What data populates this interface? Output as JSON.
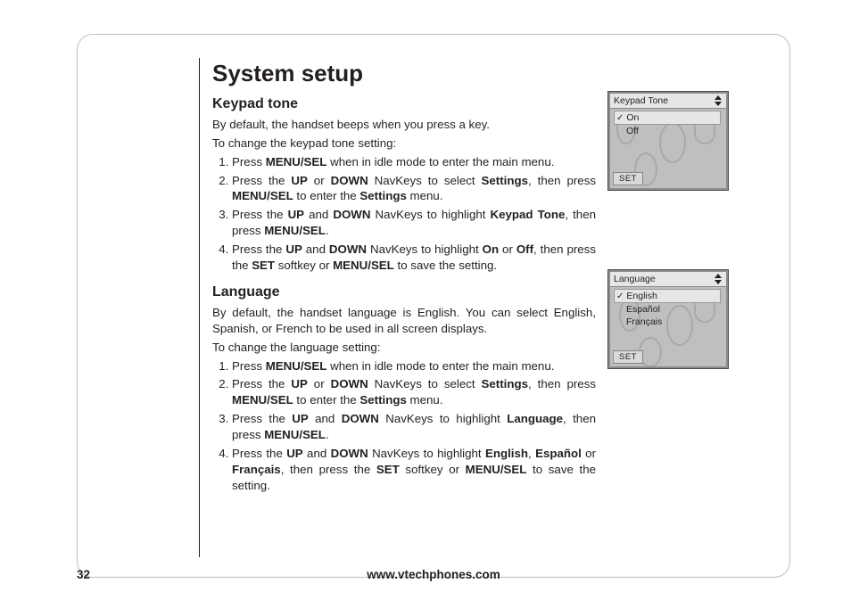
{
  "page": {
    "title": "System setup",
    "number": "32",
    "footer_url": "www.vtechphones.com"
  },
  "section1": {
    "heading": "Keypad tone",
    "intro1": "By default, the handset beeps when you press a key.",
    "intro2": "To change the keypad tone setting:",
    "steps": {
      "s1a": "Press ",
      "s1b": "MENU/SEL",
      "s1c": " when in idle mode to enter the main menu.",
      "s2a": "Press the ",
      "s2b": "UP",
      "s2c": " or ",
      "s2d": "DOWN",
      "s2e": " NavKeys to select ",
      "s2f": "Settings",
      "s2g": ", then press ",
      "s2h": "MENU/SEL",
      "s2i": " to enter the ",
      "s2j": "Settings",
      "s2k": " menu.",
      "s3a": "Press the ",
      "s3b": "UP",
      "s3c": " and ",
      "s3d": "DOWN",
      "s3e": " NavKeys to highlight ",
      "s3f": "Keypad Tone",
      "s3g": ", then press ",
      "s3h": "MENU/SEL",
      "s3i": ".",
      "s4a": "Press the ",
      "s4b": "UP",
      "s4c": " and ",
      "s4d": "DOWN",
      "s4e": " NavKeys to highlight ",
      "s4f": "On",
      "s4g": " or ",
      "s4h": "Off",
      "s4i": ", then press the ",
      "s4j": "SET",
      "s4k": " softkey or ",
      "s4l": "MENU/SEL",
      "s4m": " to save the setting."
    }
  },
  "section2": {
    "heading": "Language",
    "intro1": "By default, the handset language is English. You can select English, Spanish, or French to be used in all screen displays.",
    "intro2": "To change the language setting:",
    "steps": {
      "s1a": "Press ",
      "s1b": "MENU/SEL",
      "s1c": " when in idle mode to enter the main menu.",
      "s2a": "Press the ",
      "s2b": "UP",
      "s2c": " or ",
      "s2d": "DOWN",
      "s2e": " NavKeys to select ",
      "s2f": "Settings",
      "s2g": ", then press ",
      "s2h": "MENU/SEL",
      "s2i": " to enter the ",
      "s2j": "Settings",
      "s2k": " menu.",
      "s3a": "Press the ",
      "s3b": "UP",
      "s3c": " and ",
      "s3d": "DOWN",
      "s3e": " NavKeys to highlight ",
      "s3f": "Language",
      "s3g": ", then press ",
      "s3h": "MENU/SEL",
      "s3i": ".",
      "s4a": "Press the ",
      "s4b": "UP",
      "s4c": " and ",
      "s4d": "DOWN",
      "s4e": " NavKeys to highlight ",
      "s4f": "English",
      "s4g": ", ",
      "s4h": "Español",
      "s4i": " or ",
      "s4j": "Français",
      "s4k": ", then press the ",
      "s4l": "SET",
      "s4m": " softkey or ",
      "s4n": "MENU/SEL",
      "s4o": " to save the setting."
    }
  },
  "screen1": {
    "title": "Keypad Tone",
    "opt1": "On",
    "opt2": "Off",
    "softkey": "SET",
    "check": "✓"
  },
  "screen2": {
    "title": "Language",
    "opt1": "English",
    "opt2": "Español",
    "opt3": "Français",
    "softkey": "SET",
    "check": "✓"
  }
}
